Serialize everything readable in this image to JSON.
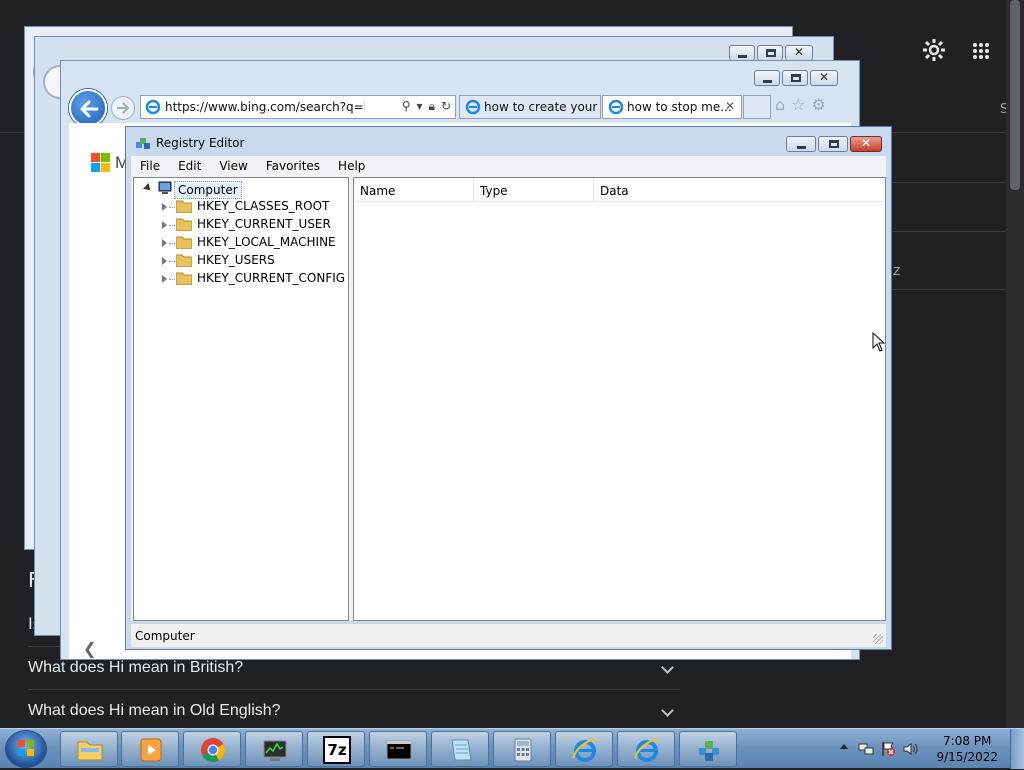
{
  "background_page": {
    "letter_s": "S",
    "letter_z": "z",
    "partial_R": "F",
    "partial_I": "Is",
    "faq": [
      {
        "question": "What does Hi mean in British?"
      },
      {
        "question": "What does Hi mean in Old English?"
      }
    ]
  },
  "browser": {
    "address": "https://www.bing.com/search?q=how+tc",
    "tabs": [
      {
        "label": "how to create your ..."
      },
      {
        "label": "how to stop me..."
      }
    ],
    "ms_letter": "M"
  },
  "registry_editor": {
    "title": "Registry Editor",
    "menu": [
      "File",
      "Edit",
      "View",
      "Favorites",
      "Help"
    ],
    "tree_root": "Computer",
    "tree_items": [
      "HKEY_CLASSES_ROOT",
      "HKEY_CURRENT_USER",
      "HKEY_LOCAL_MACHINE",
      "HKEY_USERS",
      "HKEY_CURRENT_CONFIG"
    ],
    "columns": [
      "Name",
      "Type",
      "Data"
    ],
    "status": "Computer"
  },
  "taskbar": {
    "apps": [
      "file-explorer",
      "media-player",
      "chrome",
      "task-manager",
      "7-zip",
      "command-prompt",
      "notepad",
      "calculator",
      "internet-explorer",
      "internet-explorer",
      "registry-editor"
    ],
    "sevenzip_label": "7z",
    "time": "7:08 PM",
    "date": "9/15/2022"
  }
}
